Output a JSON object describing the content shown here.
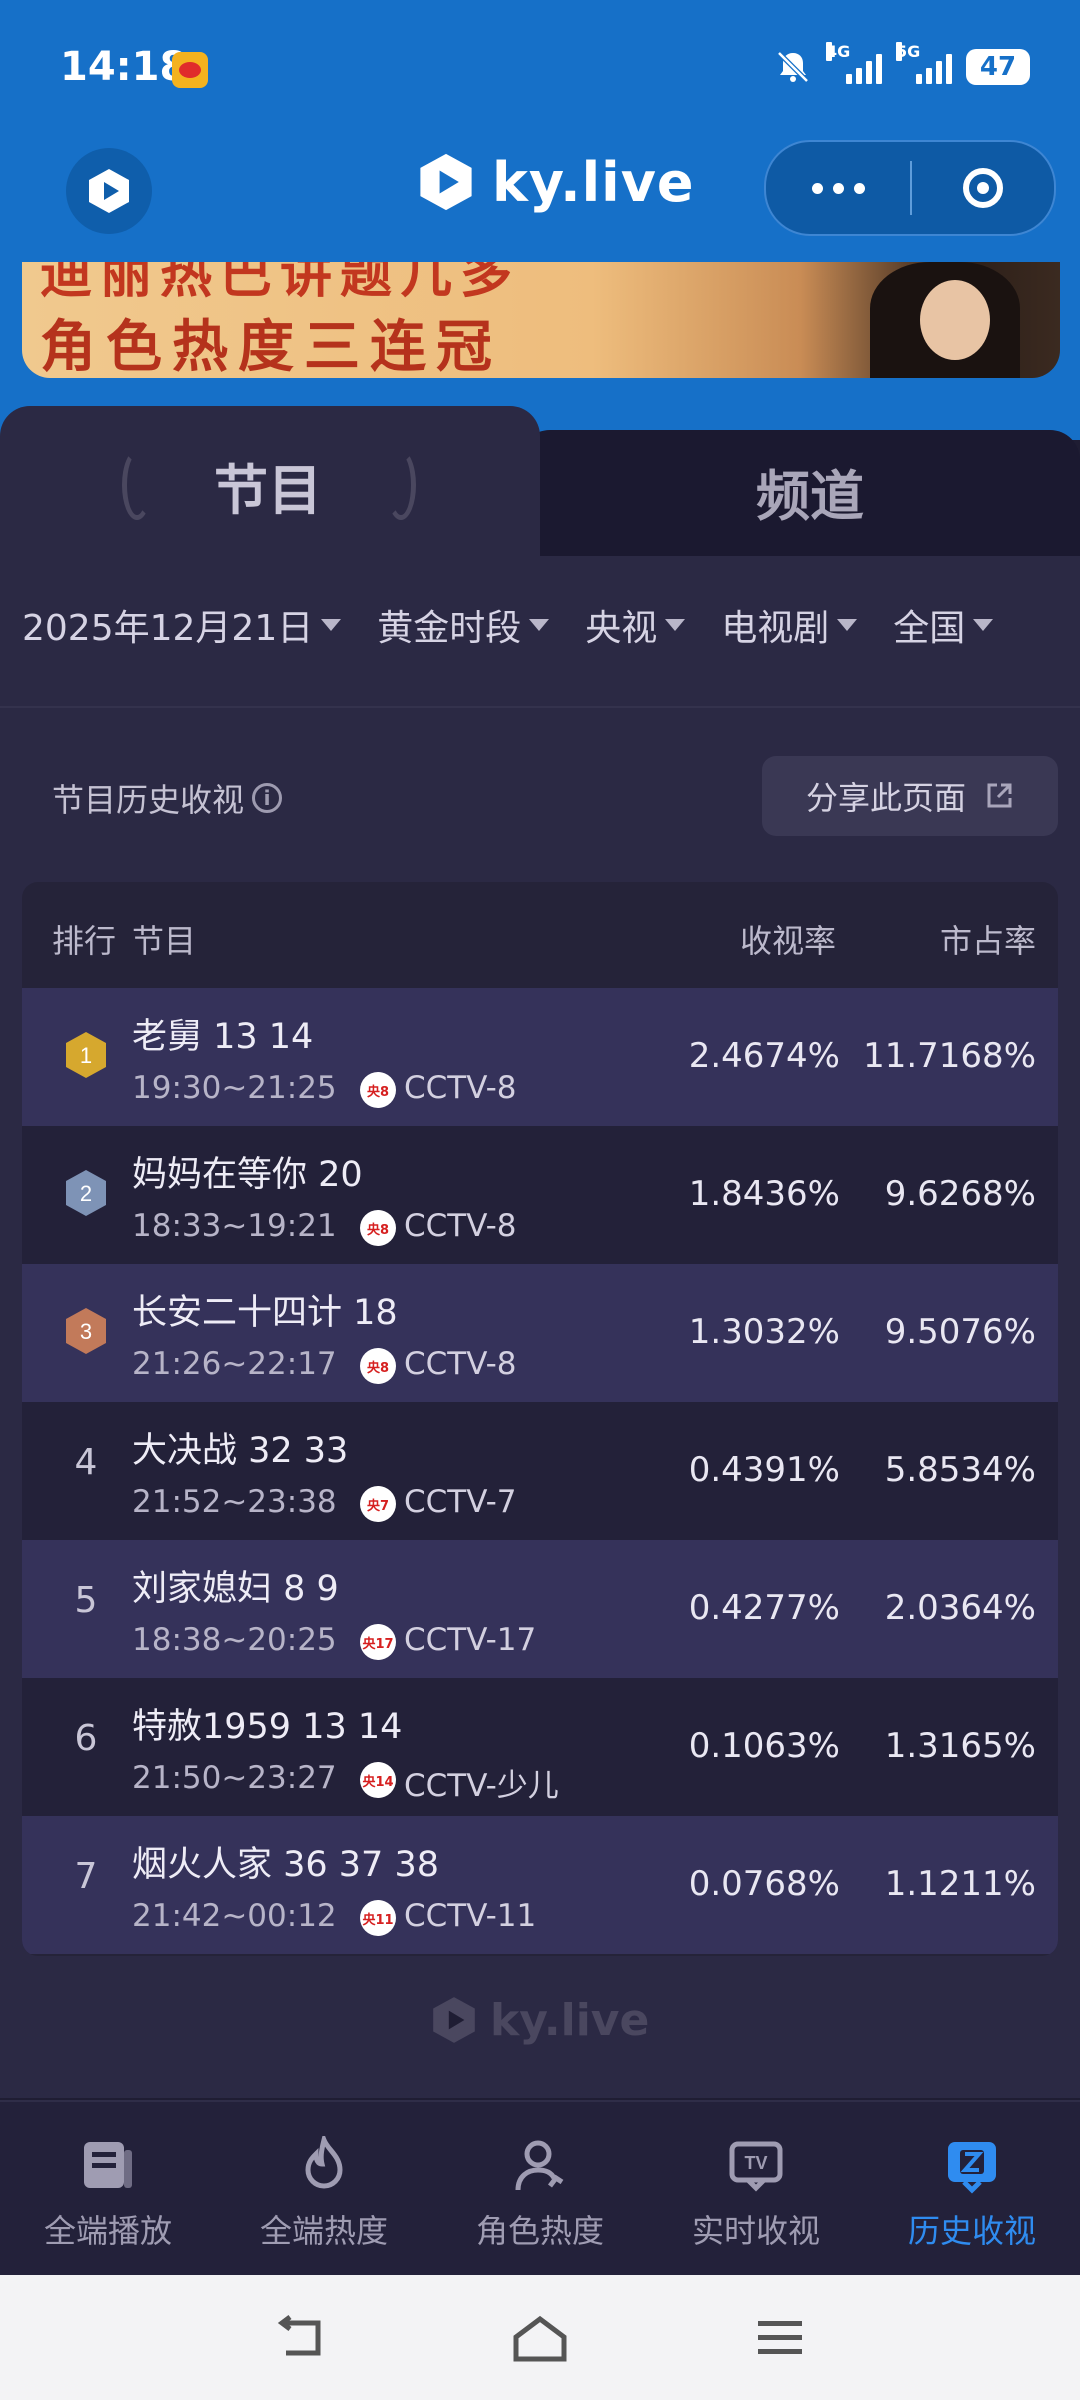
{
  "status_bar": {
    "time": "14:18",
    "battery": "47",
    "net_4g": "4G",
    "net_5g": "5G"
  },
  "header": {
    "brand": "ky.live"
  },
  "banner": {
    "line1": "迪丽热巴讲题几多",
    "line2": "角色热度三连冠"
  },
  "tabs": [
    {
      "label": "节目",
      "active": true
    },
    {
      "label": "频道",
      "active": false
    }
  ],
  "filters": [
    {
      "label": "2025年12月21日"
    },
    {
      "label": "黄金时段"
    },
    {
      "label": "央视"
    },
    {
      "label": "电视剧"
    },
    {
      "label": "全国"
    }
  ],
  "section": {
    "title": "节目历史收视",
    "share_label": "分享此页面",
    "info_glyph": "i"
  },
  "table": {
    "headers": {
      "rank": "排行",
      "program": "节目",
      "rating": "收视率",
      "share": "市占率"
    },
    "rows": [
      {
        "rank": "1",
        "title": "老舅 13 14",
        "time": "19:30~21:25",
        "channel_badge": "央8",
        "channel": "CCTV-8",
        "rating": "2.4674%",
        "share": "11.7168%"
      },
      {
        "rank": "2",
        "title": "妈妈在等你 20",
        "time": "18:33~19:21",
        "channel_badge": "央8",
        "channel": "CCTV-8",
        "rating": "1.8436%",
        "share": "9.6268%"
      },
      {
        "rank": "3",
        "title": "长安二十四计 18",
        "time": "21:26~22:17",
        "channel_badge": "央8",
        "channel": "CCTV-8",
        "rating": "1.3032%",
        "share": "9.5076%"
      },
      {
        "rank": "4",
        "title": "大决战 32 33",
        "time": "21:52~23:38",
        "channel_badge": "央7",
        "channel": "CCTV-7",
        "rating": "0.4391%",
        "share": "5.8534%"
      },
      {
        "rank": "5",
        "title": "刘家媳妇 8 9",
        "time": "18:38~20:25",
        "channel_badge": "央17",
        "channel": "CCTV-17",
        "rating": "0.4277%",
        "share": "2.0364%"
      },
      {
        "rank": "6",
        "title": "特赦1959 13 14",
        "time": "21:50~23:27",
        "channel_badge": "央14",
        "channel": "CCTV-少儿",
        "rating": "0.1063%",
        "share": "1.3165%"
      },
      {
        "rank": "7",
        "title": "烟火人家 36 37 38",
        "time": "21:42~00:12",
        "channel_badge": "央11",
        "channel": "CCTV-11",
        "rating": "0.0768%",
        "share": "1.1211%"
      }
    ]
  },
  "watermark": "ky.live",
  "bottom_nav": [
    {
      "label": "全端播放",
      "icon": "playlist-icon"
    },
    {
      "label": "全端热度",
      "icon": "flame-icon"
    },
    {
      "label": "角色热度",
      "icon": "person-icon"
    },
    {
      "label": "实时收视",
      "icon": "tv-icon"
    },
    {
      "label": "历史收视",
      "icon": "history-icon",
      "active": true
    }
  ],
  "colors": {
    "accent": "#2f8cf0",
    "header_bg": "#1670c8",
    "page_bg": "#1f1d33",
    "gold": "#d6a82e",
    "silver": "#7e93b6",
    "bronze": "#c27a5a"
  }
}
